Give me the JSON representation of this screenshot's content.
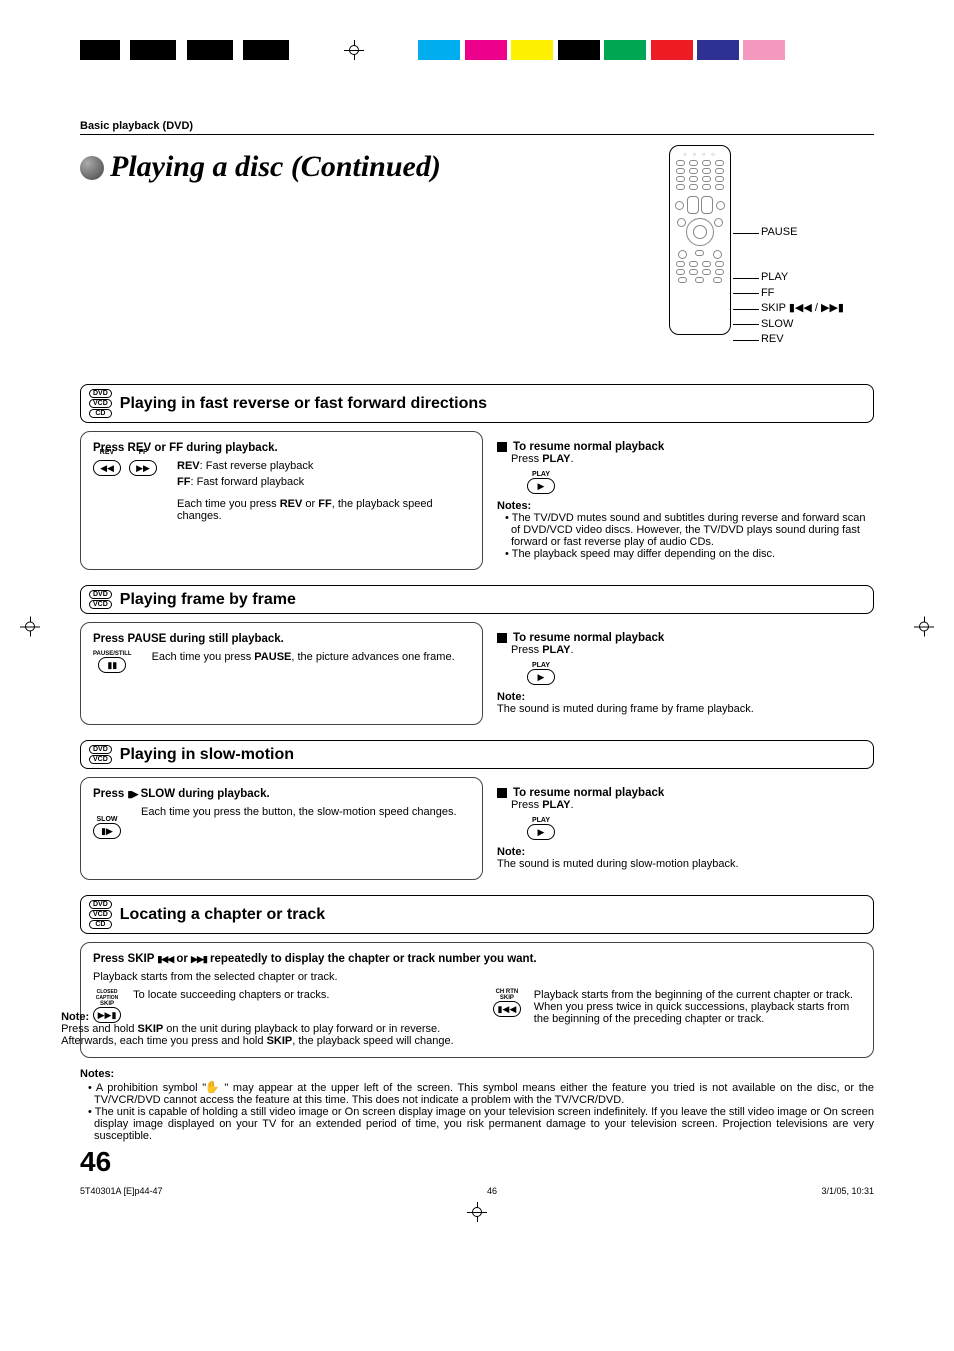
{
  "breadcrumb": "Basic playback (DVD)",
  "page_title": "Playing a disc (Continued)",
  "remote_labels": {
    "pause": "PAUSE",
    "play": "PLAY",
    "ff": "FF",
    "skip": "SKIP ▮◀◀ / ▶▶▮",
    "slow": "SLOW",
    "rev": "REV"
  },
  "sections": {
    "fastrev": {
      "discs": [
        "DVD",
        "VCD",
        "CD"
      ],
      "title": "Playing in fast reverse or fast forward directions",
      "step": "Press REV or FF during playback.",
      "rev_icon_lbl": "REV",
      "ff_icon_lbl": "FF",
      "rev_line_pre": "REV",
      "rev_line": ":  Fast reverse playback",
      "ff_line_pre": "FF",
      "ff_line": ":    Fast forward playback",
      "speed_pre": "Each time you press ",
      "speed_mid": " or ",
      "speed_post": ", the playback speed changes.",
      "rev_bold": "REV",
      "ff_bold": "FF",
      "resume_title": "To resume normal playback",
      "resume_text_pre": "Press ",
      "resume_text_bold": "PLAY",
      "resume_text_post": ".",
      "play_icon_lbl": "PLAY",
      "notes_lbl": "Notes:",
      "note1": "The TV/DVD mutes sound and subtitles during reverse and forward scan of DVD/VCD video discs. However, the TV/DVD plays sound during fast forward or fast reverse play of audio CDs.",
      "note2": "The playback speed may differ depending on the disc."
    },
    "frame": {
      "discs": [
        "DVD",
        "VCD"
      ],
      "title": "Playing frame by frame",
      "step": "Press PAUSE during still playback.",
      "icon_lbl": "PAUSE/STILL",
      "desc_pre": "Each time you press ",
      "desc_bold": "PAUSE",
      "desc_post": ", the picture advances one frame.",
      "resume_title": "To resume normal playback",
      "resume_text_pre": "Press ",
      "resume_text_bold": "PLAY",
      "resume_text_post": ".",
      "play_icon_lbl": "PLAY",
      "note_lbl": "Note:",
      "note": "The sound is muted during frame by frame playback."
    },
    "slow": {
      "discs": [
        "DVD",
        "VCD"
      ],
      "title": "Playing in slow-motion",
      "step_pre": "Press ",
      "step_sym": "▮▶",
      "step_post": "  SLOW during playback.",
      "icon_lbl": "SLOW",
      "desc": "Each time you press the button, the slow-motion speed changes.",
      "resume_title": "To resume normal playback",
      "resume_text_pre": "Press ",
      "resume_text_bold": "PLAY",
      "resume_text_post": ".",
      "play_icon_lbl": "PLAY",
      "note_lbl": "Note:",
      "note": "The sound is muted during slow-motion playback."
    },
    "locate": {
      "discs": [
        "DVD",
        "VCD",
        "CD"
      ],
      "title": "Locating a chapter or track",
      "step_pre": "Press SKIP ",
      "step_sym1": "▮◀◀",
      "step_mid": " or ",
      "step_sym2": "▶▶▮",
      "step_post": " repeatedly to display the chapter or track number you want.",
      "sub": "Playback starts from the selected chapter or track.",
      "fwd_icon_top": "CLOSED CAPTION",
      "fwd_icon_mid": "SKIP",
      "fwd_desc": "To locate succeeding chapters or tracks.",
      "back_icon_top": "CH RTN",
      "back_icon_mid": "SKIP",
      "back_desc1": "Playback starts from the beginning of the current chapter or track.",
      "back_desc2": "When you press twice in quick successions, playback starts from the beginning of the preceding chapter or track.",
      "note_lbl": "Note:",
      "note_pre": "Press and hold ",
      "note_b1": "SKIP",
      "note_mid": " on the unit during playback to play forward or in reverse. Afterwards, each time you press and hold ",
      "note_b2": "SKIP",
      "note_post": ", the playback speed will change."
    }
  },
  "bottom_notes": {
    "lbl": "Notes:",
    "n1_pre": "A prohibition symbol \" ",
    "n1_post": " \" may appear at the upper left of the screen. This symbol means either the feature you tried is not available on the disc, or the TV/VCR/DVD cannot access the feature at this time. This does not indicate a problem with the TV/VCR/DVD.",
    "n2": "The unit is capable of holding a still video image or On screen display image on your television screen indefinitely. If you leave the still video image or On screen display image displayed on your TV for an extended period of time, you risk permanent damage to your television screen. Projection televisions are very susceptible."
  },
  "page_number": "46",
  "footer": {
    "file": "5T40301A [E]p44-47",
    "page": "46",
    "date": "3/1/05, 10:31"
  }
}
